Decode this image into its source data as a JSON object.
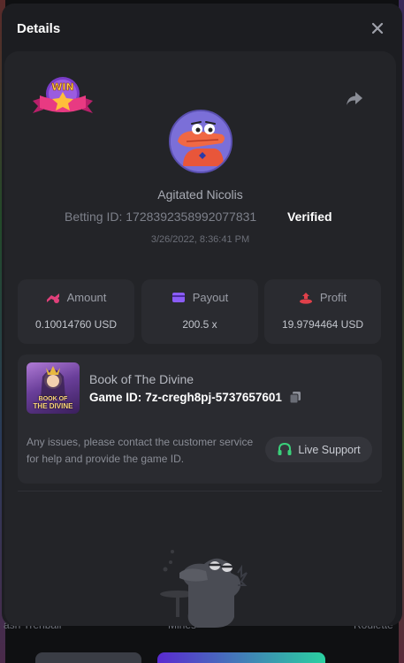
{
  "modal": {
    "title": "Details"
  },
  "bet": {
    "user_name": "Agitated Nicolis",
    "betting_id_label": "Betting ID:",
    "betting_id": "1728392358992077831",
    "verified_label": "Verified",
    "timestamp": "3/26/2022, 8:36:41 PM",
    "badge_text": "WIN"
  },
  "stats": {
    "amount": {
      "label": "Amount",
      "value": "0.10014760 USD",
      "icon": "coins-icon",
      "color": "#e0407a"
    },
    "payout": {
      "label": "Payout",
      "value": "200.5 x",
      "icon": "card-icon",
      "color": "#8a5cf6"
    },
    "profit": {
      "label": "Profit",
      "value": "19.9794464 USD",
      "icon": "profit-icon",
      "color": "#e0404a"
    }
  },
  "game": {
    "name": "Book of The Divine",
    "id_label": "Game ID:",
    "id": "7z-cregh8pj-5737657601",
    "thumb_text_1": "BOOK OF",
    "thumb_text_2": "THE DIVINE",
    "support_text": "Any issues, please contact the customer service for help and provide the game ID.",
    "live_support_label": "Live Support",
    "live_support_icon_color": "#3ad07a"
  },
  "background": {
    "label_left": "ash Trenball",
    "label_mid": "Mines",
    "label_right": "Roulette"
  }
}
